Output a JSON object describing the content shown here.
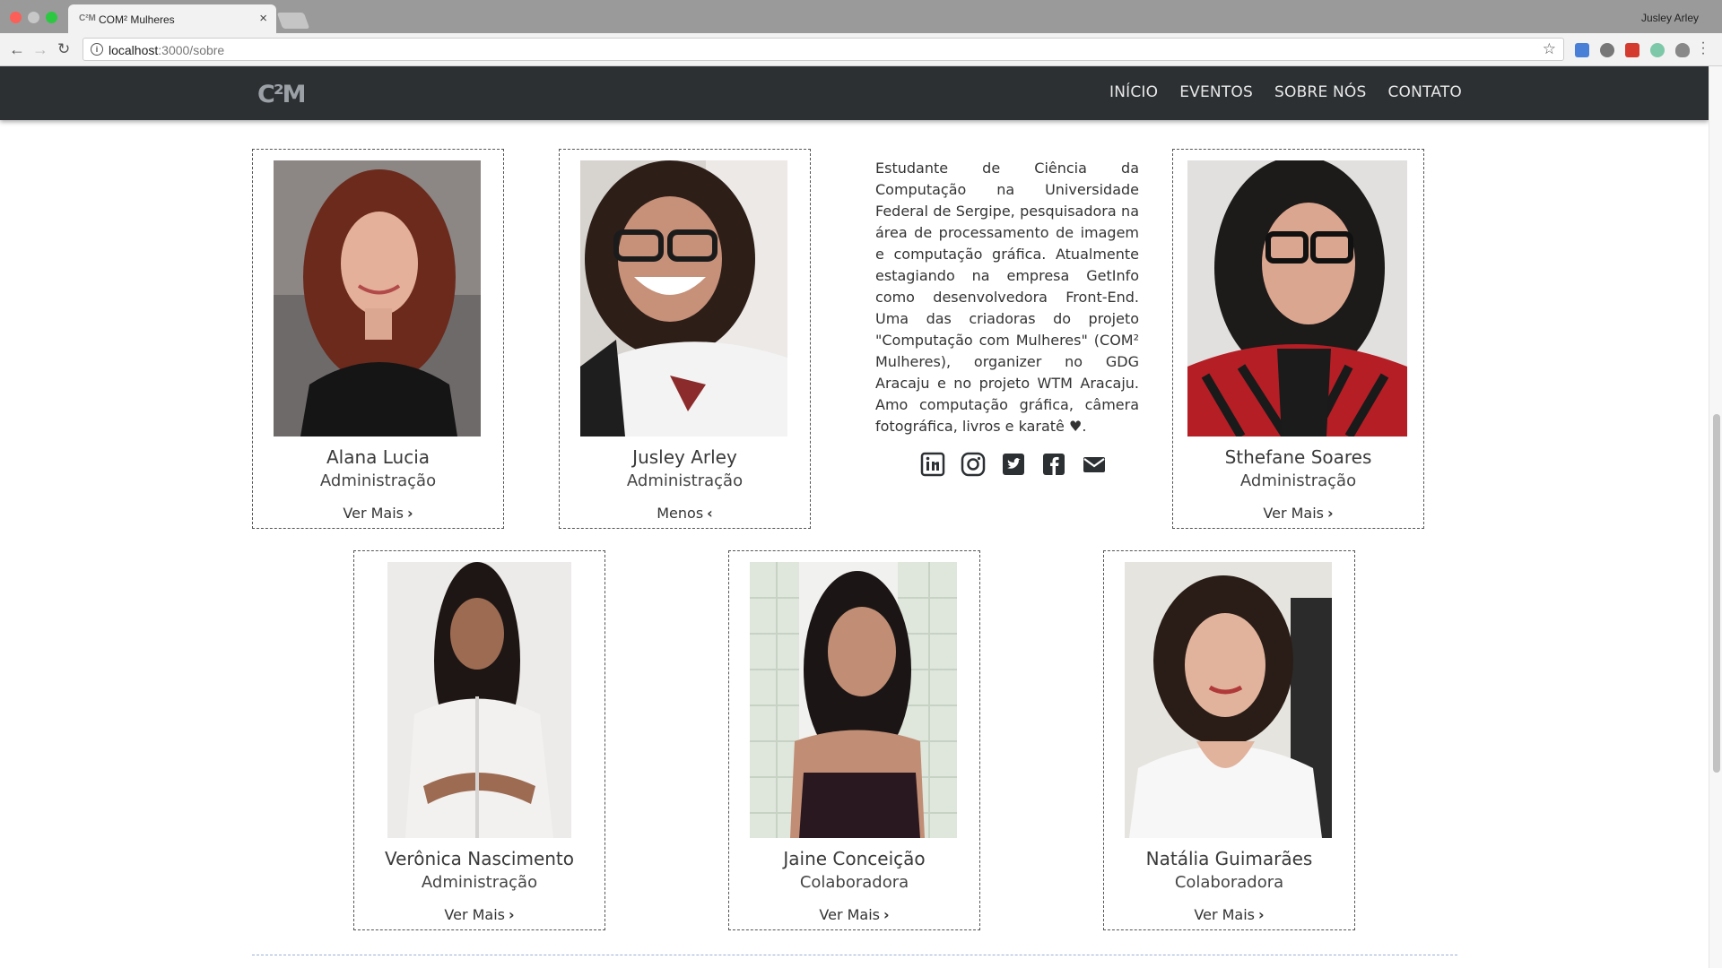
{
  "browser": {
    "tab_title": "COM² Mulheres",
    "tab_favicon": "C²M",
    "profile_name": "Jusley Arley",
    "url_host": "localhost",
    "url_path": ":3000/sobre"
  },
  "site": {
    "logo": "C²M",
    "nav": [
      "INÍCIO",
      "EVENTOS",
      "SOBRE NÓS",
      "CONTATO"
    ]
  },
  "members_row1": [
    {
      "name": "Alana Lucia",
      "role": "Administração",
      "action": "Ver Mais"
    },
    {
      "name": "Jusley Arley",
      "role": "Administração",
      "action": "Menos"
    },
    {
      "name": "Sthefane Soares",
      "role": "Administração",
      "action": "Ver Mais"
    }
  ],
  "members_row2": [
    {
      "name": "Verônica Nascimento",
      "role": "Administração",
      "action": "Ver Mais"
    },
    {
      "name": "Jaine Conceição",
      "role": "Colaboradora",
      "action": "Ver Mais"
    },
    {
      "name": "Natália Guimarães",
      "role": "Colaboradora",
      "action": "Ver Mais"
    }
  ],
  "bio": "Estudante de Ciência da Computação na Universidade Federal de Sergipe, pesquisadora na área de processamento de imagem e computação gráfica. Atualmente estagiando na empresa GetInfo como desenvolvedora Front-End. Uma das criadoras do projeto \"Computação com Mulheres\" (COM² Mulheres), organizer no GDG Aracaju e no projeto WTM Aracaju. Amo computação gráfica, câmera fotográfica, livros e karatê ♥.",
  "socials": [
    "linkedin-icon",
    "instagram-icon",
    "twitter-icon",
    "facebook-icon",
    "email-icon"
  ],
  "colors": {
    "navbar": "#2c3033",
    "card_border": "#555555",
    "icon": "#2c3033"
  }
}
